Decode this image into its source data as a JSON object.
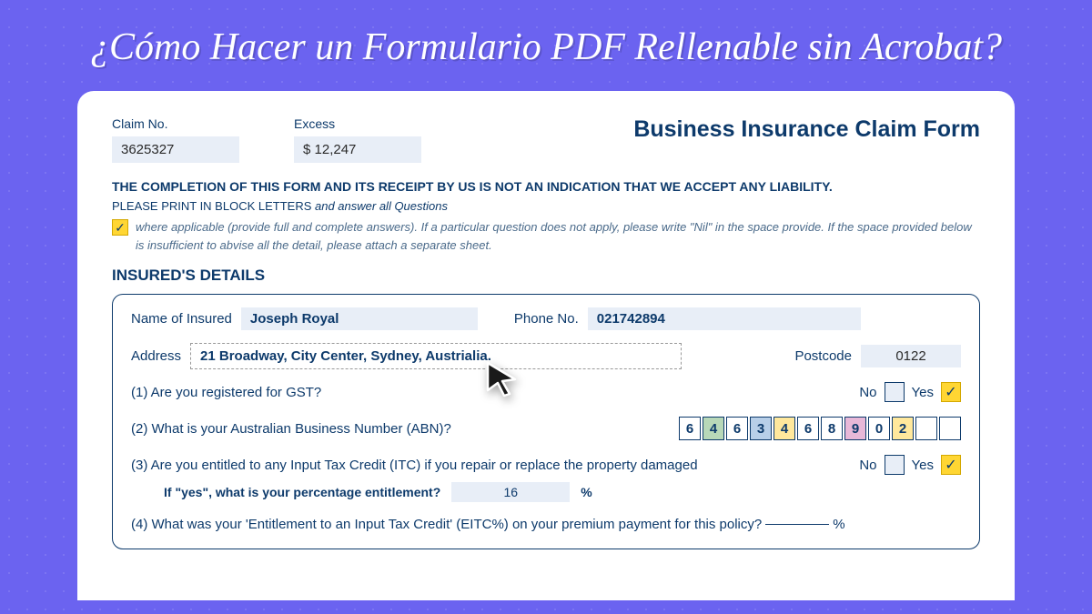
{
  "banner": "¿Cómo Hacer un Formulario PDF Rellenable sin Acrobat?",
  "form": {
    "claim_no_label": "Claim No.",
    "claim_no": "3625327",
    "excess_label": "Excess",
    "excess": "$ 12,247",
    "title": "Business Insurance Claim Form",
    "disclaimer": "THE COMPLETION OF THIS FORM AND ITS RECEIPT BY US IS NOT AN INDICATION THAT WE ACCEPT ANY LIABILITY.",
    "print_note_a": "PLEASE PRINT IN BLOCK LETTERS ",
    "print_note_b": "and answer all Questions",
    "applicable": "where applicable (provide full and complete answers). If a particular question does not apply, please write \"Nil\" in the space provide. If the space provided below is insufficient to abvise all the detail, please attach a separate sheet.",
    "section": "INSURED'S DETAILS",
    "name_label": "Name of Insured",
    "name": "Joseph Royal",
    "phone_label": "Phone No.",
    "phone": "021742894",
    "address_label": "Address",
    "address": "21 Broadway, City Center, Sydney, Austrialia.",
    "postcode_label": "Postcode",
    "postcode": "0122",
    "q1": "(1) Are you registered for GST?",
    "q2": "(2) What is your Australian Business Number (ABN)?",
    "q3": "(3) Are you entitled to any Input Tax Credit (ITC) if you repair or replace the property damaged",
    "q3_sub": "If \"yes\", what is your percentage entitlement?",
    "q3_pct": "16",
    "q4": "(4) What was your 'Entitlement to an Input Tax Credit' (EITC%) on your premium payment for this policy?",
    "no": "No",
    "yes": "Yes",
    "pct": "%",
    "abn": [
      "6",
      "4",
      "6",
      "3",
      "4",
      "6",
      "8",
      "9",
      "0",
      "2",
      "",
      ""
    ],
    "abn_colors": [
      "#fff",
      "#b8d8b8",
      "#fff",
      "#b8cfe8",
      "#ffe89c",
      "#fff",
      "#fff",
      "#e8b8d8",
      "#fff",
      "#ffe89c",
      "#fff",
      "#fff"
    ]
  }
}
